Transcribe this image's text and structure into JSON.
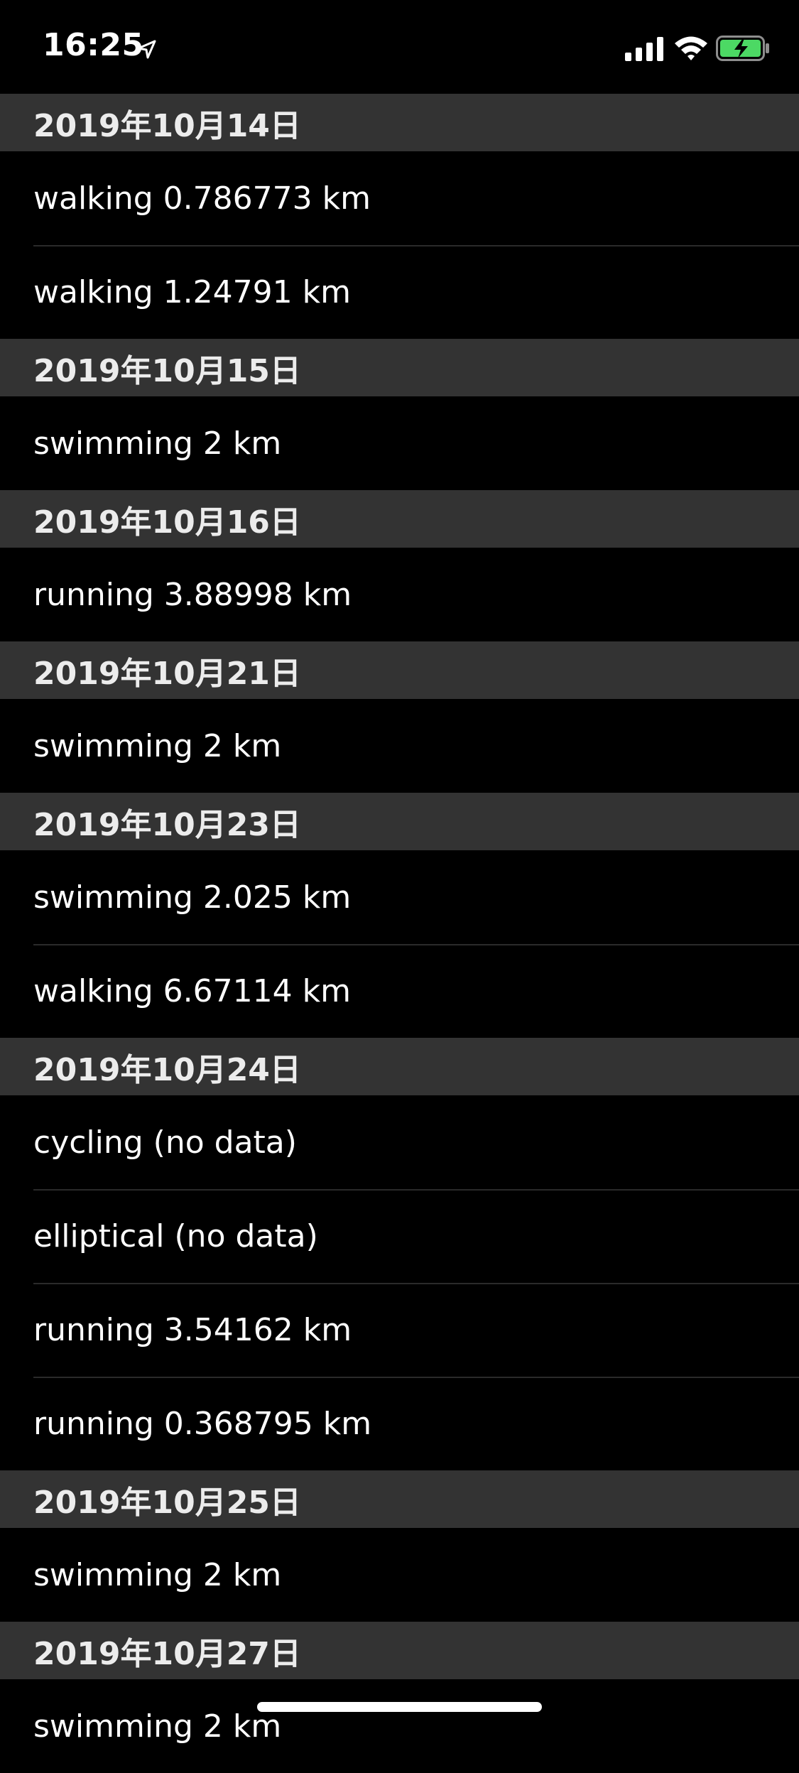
{
  "status_bar": {
    "time": "16:25",
    "battery_color": "#4cd964"
  },
  "sections": [
    {
      "date": "2019年10月14日",
      "items": [
        "walking 0.786773 km",
        "walking 1.24791 km"
      ]
    },
    {
      "date": "2019年10月15日",
      "items": [
        "swimming 2 km"
      ]
    },
    {
      "date": "2019年10月16日",
      "items": [
        "running 3.88998 km"
      ]
    },
    {
      "date": "2019年10月21日",
      "items": [
        "swimming 2 km"
      ]
    },
    {
      "date": "2019年10月23日",
      "items": [
        "swimming 2.025 km",
        "walking 6.67114 km"
      ]
    },
    {
      "date": "2019年10月24日",
      "items": [
        "cycling (no data)",
        "elliptical (no data)",
        "running 3.54162 km",
        "running 0.368795 km"
      ]
    },
    {
      "date": "2019年10月25日",
      "items": [
        "swimming 2 km"
      ]
    },
    {
      "date": "2019年10月27日",
      "items": [
        "swimming 2 km"
      ]
    }
  ]
}
